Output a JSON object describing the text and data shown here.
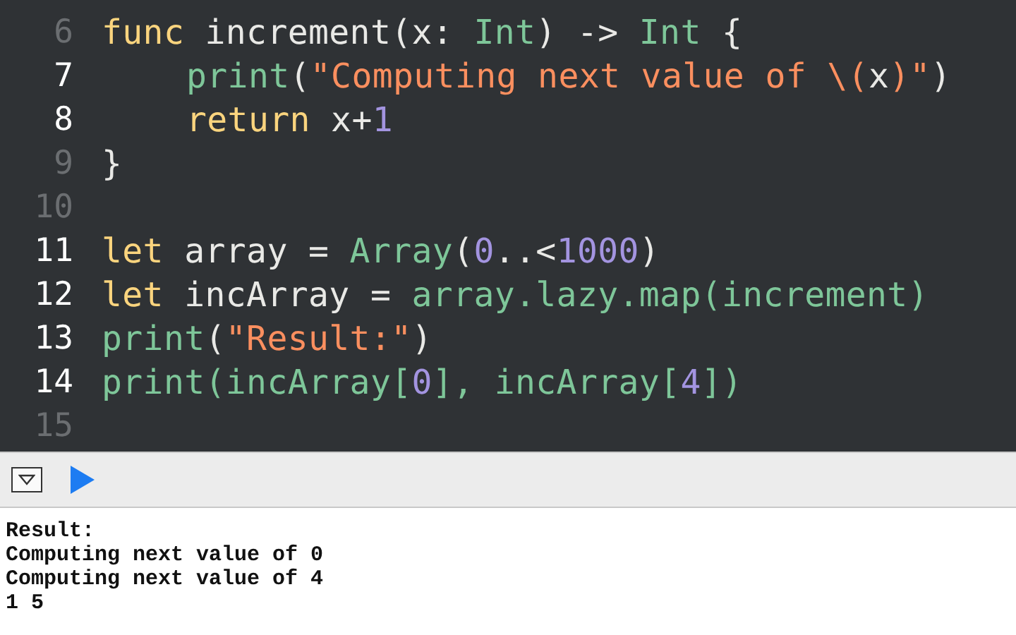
{
  "editor": {
    "lines": [
      {
        "number": "6",
        "active": false,
        "tokens": [
          {
            "kind": "keyword",
            "text": "func"
          },
          {
            "kind": "plain",
            "text": " increment(x: "
          },
          {
            "kind": "type",
            "text": "Int"
          },
          {
            "kind": "plain",
            "text": ") -> "
          },
          {
            "kind": "type",
            "text": "Int"
          },
          {
            "kind": "plain",
            "text": " {"
          }
        ],
        "children": [
          {
            "number": "7",
            "active": true,
            "tokens": [
              {
                "kind": "type",
                "text": "print"
              },
              {
                "kind": "plain",
                "text": "("
              },
              {
                "kind": "string",
                "text": "\"Computing next value of \\("
              },
              {
                "kind": "plain",
                "text": "x"
              },
              {
                "kind": "string",
                "text": ")\""
              },
              {
                "kind": "plain",
                "text": ")"
              }
            ]
          },
          {
            "number": "8",
            "active": true,
            "tokens": [
              {
                "kind": "keyword",
                "text": "return"
              },
              {
                "kind": "plain",
                "text": " x+"
              },
              {
                "kind": "number",
                "text": "1"
              }
            ]
          }
        ]
      },
      {
        "number": "9",
        "active": false,
        "tokens": [
          {
            "kind": "plain",
            "text": "}"
          }
        ]
      },
      {
        "number": "10",
        "active": false
      },
      {
        "number": "11",
        "active": true,
        "tokens": [
          {
            "kind": "keyword",
            "text": "let"
          },
          {
            "kind": "plain",
            "text": " array = "
          },
          {
            "kind": "type",
            "text": "Array"
          },
          {
            "kind": "plain",
            "text": "("
          },
          {
            "kind": "number",
            "text": "0"
          },
          {
            "kind": "plain",
            "text": "..<"
          },
          {
            "kind": "number",
            "text": "1000"
          },
          {
            "kind": "plain",
            "text": ")"
          }
        ]
      },
      {
        "number": "12",
        "active": true,
        "tokens": [
          {
            "kind": "keyword",
            "text": "let"
          },
          {
            "kind": "plain",
            "text": " incArray = "
          },
          {
            "kind": "type",
            "text": "array.lazy.map(increment)"
          }
        ]
      },
      {
        "number": "13",
        "active": true,
        "tokens": [
          {
            "kind": "type",
            "text": "print"
          },
          {
            "kind": "plain",
            "text": "("
          },
          {
            "kind": "string",
            "text": "\"Result:\""
          },
          {
            "kind": "plain",
            "text": ")"
          }
        ]
      },
      {
        "number": "14",
        "active": true,
        "tokens": [
          {
            "kind": "type",
            "text": "print(incArray["
          },
          {
            "kind": "number",
            "text": "0"
          },
          {
            "kind": "type",
            "text": "], incArray["
          },
          {
            "kind": "number",
            "text": "4"
          },
          {
            "kind": "type",
            "text": "])"
          }
        ]
      },
      {
        "number": "15",
        "active": false
      }
    ]
  },
  "console": {
    "lines": [
      "Result:",
      "Computing next value of 0",
      "Computing next value of 4",
      "1 5"
    ]
  }
}
